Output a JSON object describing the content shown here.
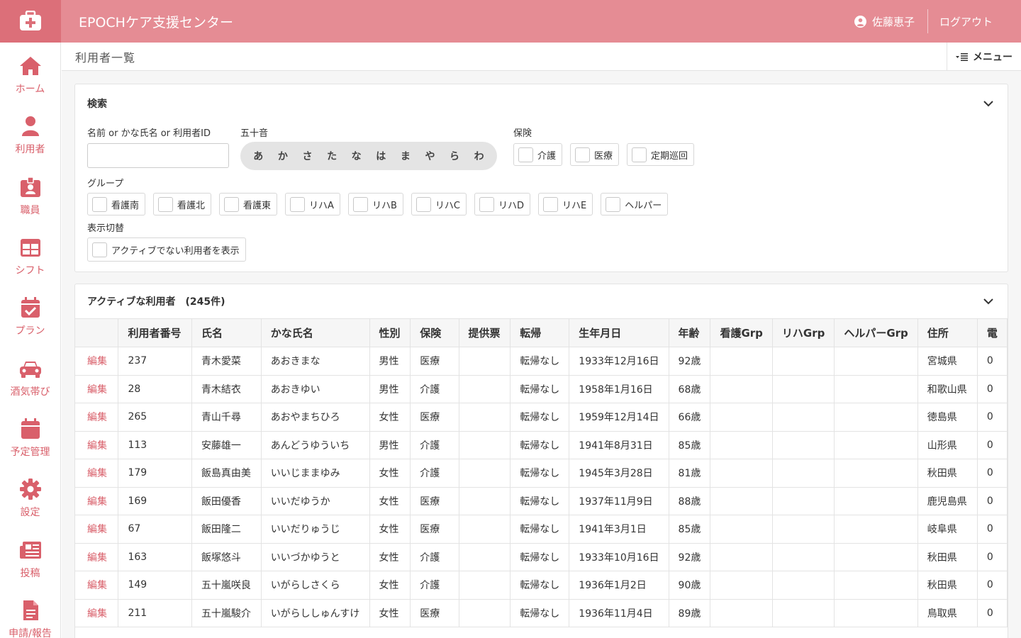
{
  "header": {
    "app_title": "EPOCHケア支援センター",
    "user_name": "佐藤恵子",
    "logout_label": "ログアウト",
    "brand_color": "#e58c94"
  },
  "sidebar": {
    "items": [
      {
        "label": "ホーム",
        "icon": "home-icon"
      },
      {
        "label": "利用者",
        "icon": "user-icon"
      },
      {
        "label": "職員",
        "icon": "staff-badge-icon"
      },
      {
        "label": "シフト",
        "icon": "table-icon"
      },
      {
        "label": "プラン",
        "icon": "calendar-check-icon"
      },
      {
        "label": "酒気帯び",
        "icon": "car-icon"
      },
      {
        "label": "予定管理",
        "icon": "calendar-icon"
      },
      {
        "label": "設定",
        "icon": "gear-icon"
      },
      {
        "label": "投稿",
        "icon": "newspaper-icon"
      },
      {
        "label": "申請/報告",
        "icon": "document-icon"
      }
    ]
  },
  "page": {
    "title": "利用者一覧",
    "menu_label": "メニュー"
  },
  "search": {
    "title": "検索",
    "name_label": "名前 or かな氏名 or 利用者ID",
    "name_value": "",
    "kana_label": "五十音",
    "kana": [
      "あ",
      "か",
      "さ",
      "た",
      "な",
      "は",
      "ま",
      "や",
      "ら",
      "わ"
    ],
    "insurance_label": "保険",
    "insurance": [
      "介護",
      "医療",
      "定期巡回"
    ],
    "group_label": "グループ",
    "groups": [
      "看護南",
      "看護北",
      "看護東",
      "リハA",
      "リハB",
      "リハC",
      "リハD",
      "リハE",
      "ヘルパー"
    ],
    "display_label": "表示切替",
    "display_option": "アクティブでない利用者を表示"
  },
  "list": {
    "title": "アクティブな利用者",
    "count": "(245件)",
    "edit_label": "編集",
    "columns": [
      "",
      "利用者番号",
      "氏名",
      "かな氏名",
      "性別",
      "保険",
      "提供票",
      "転帰",
      "生年月日",
      "年齢",
      "看護Grp",
      "リハGrp",
      "ヘルパーGrp",
      "住所",
      "電"
    ],
    "rows": [
      {
        "id": "237",
        "name": "青木愛菜",
        "kana": "あおきまな",
        "sex": "男性",
        "insurance": "医療",
        "ticket": "",
        "outcome": "転帰なし",
        "birth": "1933年12月16日",
        "age": "92歳",
        "nurse": "",
        "rehab": "",
        "helper": "",
        "address": "宮城県",
        "phone": "0"
      },
      {
        "id": "28",
        "name": "青木結衣",
        "kana": "あおきゆい",
        "sex": "男性",
        "insurance": "介護",
        "ticket": "",
        "outcome": "転帰なし",
        "birth": "1958年1月16日",
        "age": "68歳",
        "nurse": "",
        "rehab": "",
        "helper": "",
        "address": "和歌山県",
        "phone": "0"
      },
      {
        "id": "265",
        "name": "青山千尋",
        "kana": "あおやまちひろ",
        "sex": "女性",
        "insurance": "医療",
        "ticket": "",
        "outcome": "転帰なし",
        "birth": "1959年12月14日",
        "age": "66歳",
        "nurse": "",
        "rehab": "",
        "helper": "",
        "address": "徳島県",
        "phone": "0"
      },
      {
        "id": "113",
        "name": "安藤雄一",
        "kana": "あんどうゆういち",
        "sex": "男性",
        "insurance": "介護",
        "ticket": "",
        "outcome": "転帰なし",
        "birth": "1941年8月31日",
        "age": "85歳",
        "nurse": "",
        "rehab": "",
        "helper": "",
        "address": "山形県",
        "phone": "0"
      },
      {
        "id": "179",
        "name": "飯島真由美",
        "kana": "いいじままゆみ",
        "sex": "女性",
        "insurance": "介護",
        "ticket": "",
        "outcome": "転帰なし",
        "birth": "1945年3月28日",
        "age": "81歳",
        "nurse": "",
        "rehab": "",
        "helper": "",
        "address": "秋田県",
        "phone": "0"
      },
      {
        "id": "169",
        "name": "飯田優香",
        "kana": "いいだゆうか",
        "sex": "女性",
        "insurance": "医療",
        "ticket": "",
        "outcome": "転帰なし",
        "birth": "1937年11月9日",
        "age": "88歳",
        "nurse": "",
        "rehab": "",
        "helper": "",
        "address": "鹿児島県",
        "phone": "0"
      },
      {
        "id": "67",
        "name": "飯田隆二",
        "kana": "いいだりゅうじ",
        "sex": "女性",
        "insurance": "医療",
        "ticket": "",
        "outcome": "転帰なし",
        "birth": "1941年3月1日",
        "age": "85歳",
        "nurse": "",
        "rehab": "",
        "helper": "",
        "address": "岐阜県",
        "phone": "0"
      },
      {
        "id": "163",
        "name": "飯塚悠斗",
        "kana": "いいづかゆうと",
        "sex": "女性",
        "insurance": "介護",
        "ticket": "",
        "outcome": "転帰なし",
        "birth": "1933年10月16日",
        "age": "92歳",
        "nurse": "",
        "rehab": "",
        "helper": "",
        "address": "秋田県",
        "phone": "0"
      },
      {
        "id": "149",
        "name": "五十嵐咲良",
        "kana": "いがらしさくら",
        "sex": "女性",
        "insurance": "介護",
        "ticket": "",
        "outcome": "転帰なし",
        "birth": "1936年1月2日",
        "age": "90歳",
        "nurse": "",
        "rehab": "",
        "helper": "",
        "address": "秋田県",
        "phone": "0"
      },
      {
        "id": "211",
        "name": "五十嵐駿介",
        "kana": "いがらししゅんすけ",
        "sex": "女性",
        "insurance": "医療",
        "ticket": "",
        "outcome": "転帰なし",
        "birth": "1936年11月4日",
        "age": "89歳",
        "nurse": "",
        "rehab": "",
        "helper": "",
        "address": "鳥取県",
        "phone": "0"
      }
    ]
  }
}
